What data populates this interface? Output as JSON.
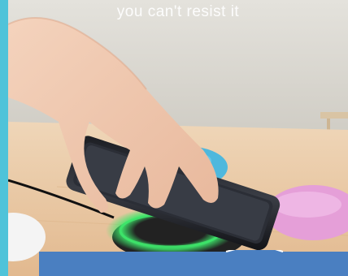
{
  "headline": "you can't resist it",
  "colors": {
    "accent_strip": "#4fc3d9",
    "banner": "#4a7fc1",
    "wall": "#d8d6cf",
    "table": "#e8c9a6",
    "pad_blue": "#4fb8dd",
    "pad_pink": "#e59fd8",
    "charging_glow": "#3ee86b"
  },
  "image": {
    "subject": "hand placing smartphone on wireless charging pad",
    "icons": [
      "hand",
      "smartphone",
      "charging-pad-blue",
      "charging-pad-pink",
      "charging-pad-white",
      "charging-glow"
    ]
  }
}
